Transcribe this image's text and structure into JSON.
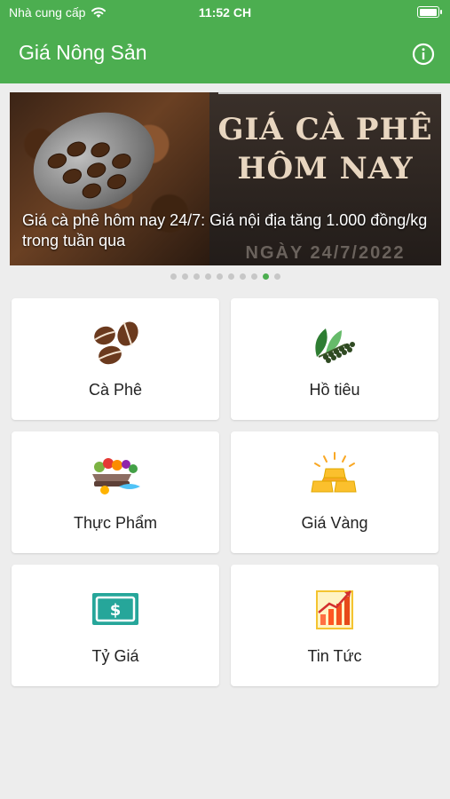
{
  "status_bar": {
    "carrier": "Nhà cung cấp",
    "time": "11:52 CH",
    "battery_level": 1.0
  },
  "app_bar": {
    "title": "Giá Nông Sản",
    "info_icon": "info-icon"
  },
  "banner": {
    "image_headline_line1": "GIÁ CÀ PHÊ",
    "image_headline_line2": "HÔM NAY",
    "image_date": "NGÀY 24/7/2022",
    "caption": "Giá cà phê hôm nay 24/7: Giá nội địa tăng 1.000 đồng/kg trong tuần qua",
    "slide_count": 10,
    "active_slide": 9
  },
  "menu": [
    {
      "label": "Cà Phê",
      "icon": "coffee-beans-icon"
    },
    {
      "label": "Hồ tiêu",
      "icon": "pepper-icon"
    },
    {
      "label": "Thực Phẩm",
      "icon": "food-icon"
    },
    {
      "label": "Giá Vàng",
      "icon": "gold-bars-icon"
    },
    {
      "label": "Tỷ Giá",
      "icon": "dollar-bill-icon"
    },
    {
      "label": "Tin Tức",
      "icon": "news-chart-icon"
    }
  ],
  "colors": {
    "primary": "#4cae50",
    "background": "#ededed",
    "tile": "#ffffff"
  }
}
